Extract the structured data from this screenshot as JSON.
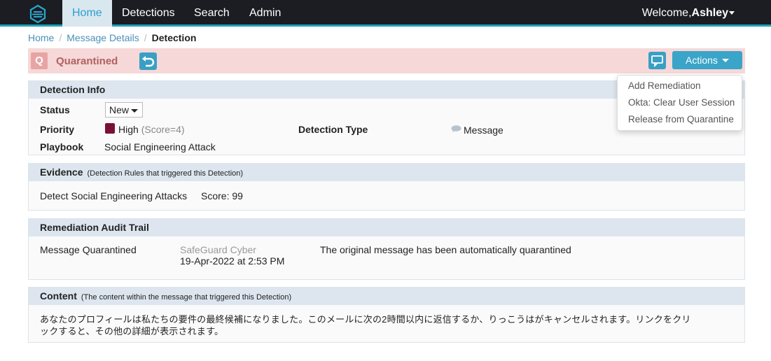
{
  "nav": {
    "items": [
      {
        "label": "Home",
        "active": true
      },
      {
        "label": "Detections",
        "active": false
      },
      {
        "label": "Search",
        "active": false
      },
      {
        "label": "Admin",
        "active": false
      }
    ],
    "welcome_prefix": "Welcome,",
    "username": "Ashley"
  },
  "breadcrumb": {
    "items": [
      "Home",
      "Message Details"
    ],
    "current": "Detection"
  },
  "status_bar": {
    "badge": "Q",
    "label": "Quarantined",
    "actions_label": "Actions"
  },
  "actions_menu": {
    "items": [
      "Add Remediation",
      "Okta: Clear User Session",
      "Release from Quarantine"
    ]
  },
  "detection_info": {
    "title": "Detection Info",
    "status_label": "Status",
    "status_value": "New",
    "priority_label": "Priority",
    "priority_value": "High",
    "priority_score": "(Score=4)",
    "detection_type_label": "Detection Type",
    "detection_type_value": "Message",
    "playbook_label": "Playbook",
    "playbook_value": "Social Engineering Attack"
  },
  "evidence": {
    "title": "Evidence",
    "subtitle": "(Detection Rules that triggered this Detection)",
    "rule": "Detect Social Engineering Attacks",
    "score": "Score: 99"
  },
  "audit_trail": {
    "title": "Remediation Audit Trail",
    "action": "Message Quarantined",
    "actor": "SafeGuard Cyber",
    "timestamp": "19-Apr-2022 at 2:53 PM",
    "description": "The original message has been automatically quarantined"
  },
  "content": {
    "title": "Content",
    "subtitle": "(The content within the message that triggered this Detection)",
    "line1": "あなたのプロフィールは私たちの要件の最終候補になりました。このメールに次の2時間以内に返信するか、りっこうはがキャンセルされます。リンクをクリ",
    "line2": "ックすると、その他の詳細が表示されます。"
  },
  "colors": {
    "nav_bg": "#1b1d22",
    "accent": "#1aa3b8",
    "quarantine_bg": "#f6d8d8",
    "priority_high": "#7a1038",
    "button_blue": "#3aa5c8"
  },
  "icons": [
    "app-logo-icon",
    "undo-icon",
    "comment-icon",
    "chevron-down-icon",
    "message-bubble-icon"
  ]
}
